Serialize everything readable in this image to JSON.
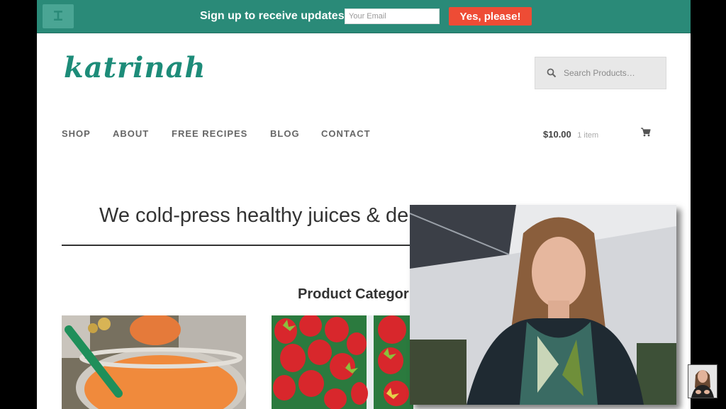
{
  "signup_bar": {
    "label": "Sign up to receive updates",
    "email_placeholder": "Your Email",
    "submit_label": "Yes, please!"
  },
  "header": {
    "logo_text": "katrinah",
    "search_placeholder": "Search Products…"
  },
  "nav": {
    "items": [
      {
        "label": "SHOP"
      },
      {
        "label": "ABOUT"
      },
      {
        "label": "FREE RECIPES"
      },
      {
        "label": "BLOG"
      },
      {
        "label": "CONTACT"
      }
    ]
  },
  "cart": {
    "amount": "$10.00",
    "count": "1 item"
  },
  "hero": {
    "tagline": "We cold-press healthy juices & delive"
  },
  "products": {
    "heading": "Product Categor"
  },
  "icons": {
    "bar_logo": "hackeryou-logo-icon",
    "search": "search-icon",
    "cart": "shopping-cart-icon"
  },
  "colors": {
    "bar_green": "#2a8a78",
    "logo_green": "#1d8c79",
    "button_red": "#ee4c35"
  }
}
